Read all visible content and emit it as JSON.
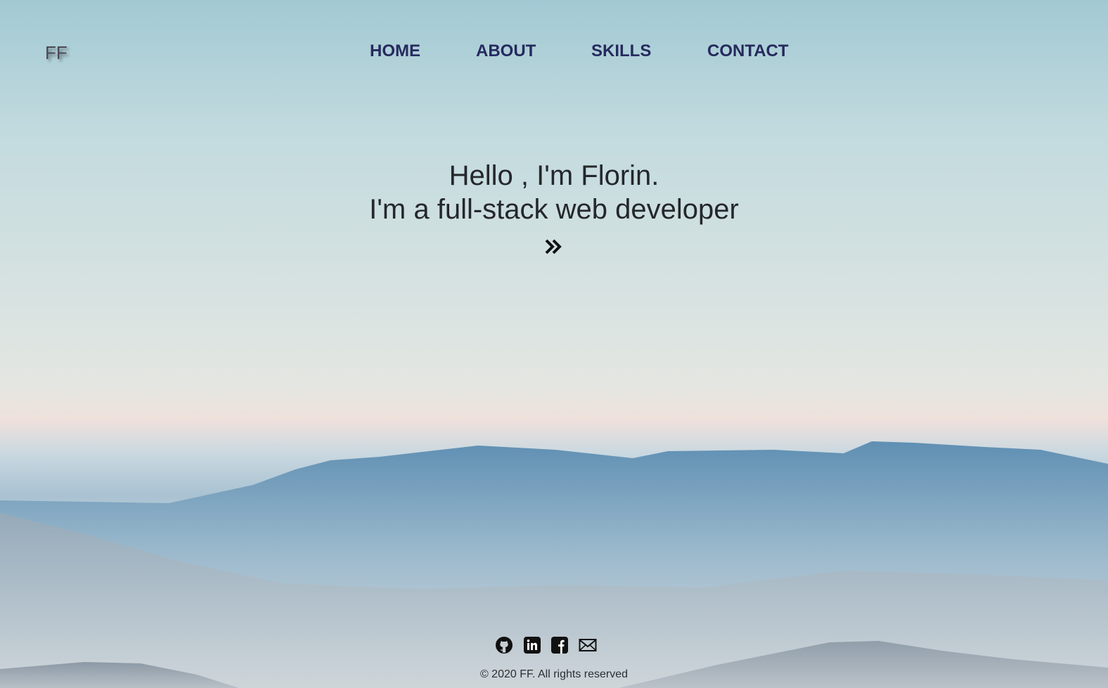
{
  "logo": "FF",
  "nav": {
    "home": "HOME",
    "about": "ABOUT",
    "skills": "SKILLS",
    "contact": "CONTACT"
  },
  "hero": {
    "greeting": "Hello , I'm Florin.",
    "tagline": "I'm a full-stack web developer",
    "arrow_icon": "double-chevron-right-icon"
  },
  "footer": {
    "social_icons": [
      "github-icon",
      "linkedin-icon",
      "facebook-icon",
      "mail-icon"
    ],
    "copyright": "© 2020 FF. All rights reserved"
  },
  "colors": {
    "nav_text": "#262a5e",
    "hero_text": "#24272b",
    "mountain_blue": "#6a98b8"
  }
}
